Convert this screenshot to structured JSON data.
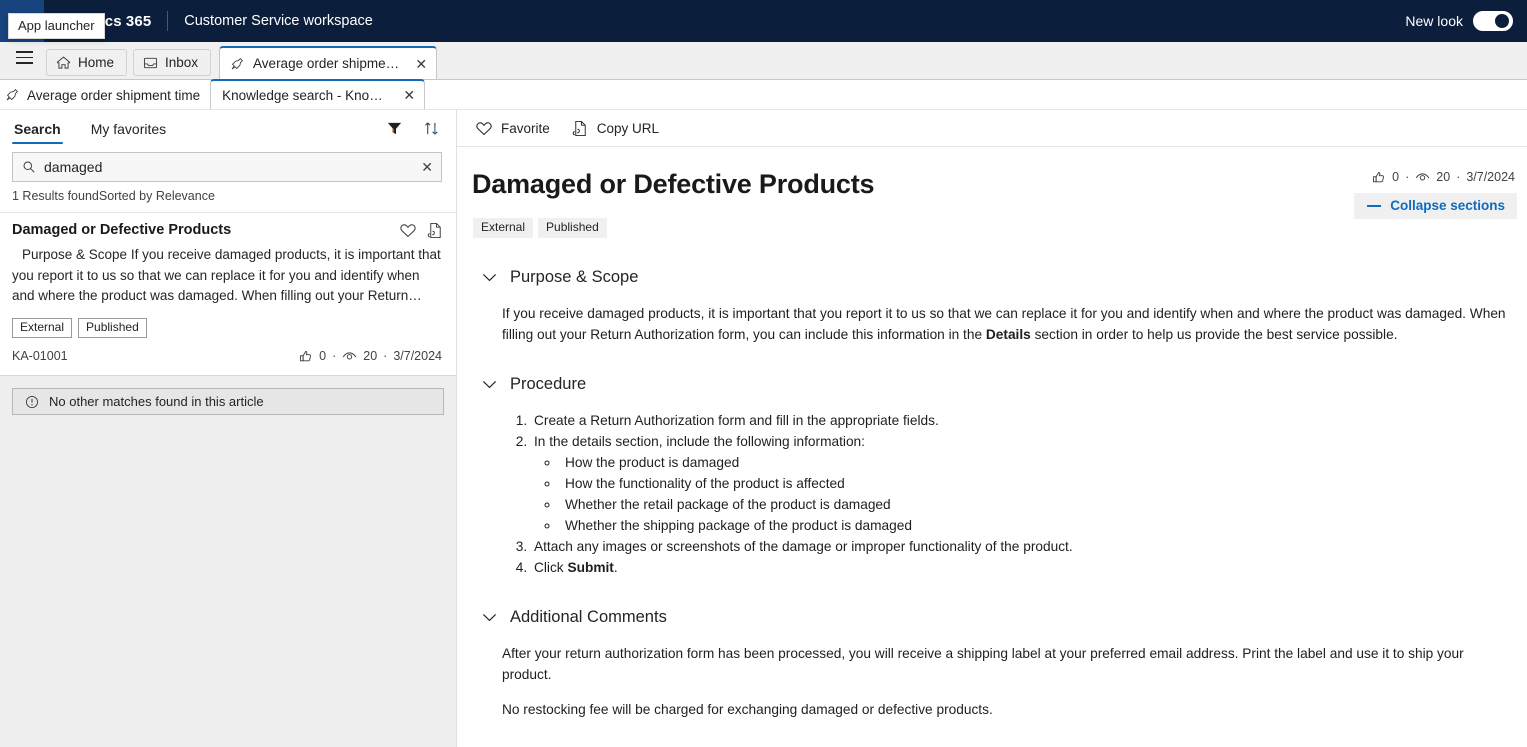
{
  "header": {
    "app_launcher_tooltip": "App launcher",
    "brand": "Dynamics 365",
    "app_name": "Customer Service workspace",
    "new_look_label": "New look",
    "new_look_state": "on",
    "bar_color": "#0b1f3c",
    "accent_color": "#0f6cbd"
  },
  "tabs_primary": [
    {
      "label": "Home",
      "icon": "home-icon"
    },
    {
      "label": "Inbox",
      "icon": "inbox-icon"
    },
    {
      "label": "Average order shipment ti...",
      "icon": "pin-icon",
      "active": true,
      "closable": true
    }
  ],
  "tabs_secondary": [
    {
      "label": "Average order shipment time",
      "icon": "pin-icon",
      "active": false
    },
    {
      "label": "Knowledge search - Knowled...",
      "active": true,
      "closable": true
    }
  ],
  "search_panel": {
    "tabs": [
      {
        "label": "Search",
        "active": true
      },
      {
        "label": "My favorites",
        "active": false
      }
    ],
    "filter_icon": "filter-icon",
    "sort_icon": "sort-icon",
    "search": {
      "value": "damaged",
      "placeholder": "Search",
      "icon": "search-icon",
      "clear_icon": "clear-icon"
    },
    "results_count_text": "1 Results found",
    "sort_text": "Sorted by Relevance",
    "result_card": {
      "title": "Damaged or Defective Products",
      "favorite_icon": "heart-icon",
      "copy_icon": "copy-url-icon",
      "snippet": "Purpose & Scope If you receive damaged products, it is important that you report it to us so that we can replace it for you and identify when and where the product was damaged. When filling out your Return…",
      "badges": [
        "External",
        "Published"
      ],
      "article_number": "KA-01001",
      "likes": "0",
      "views": "20",
      "date": "3/7/2024",
      "separator": "·"
    },
    "no_matches_text": "No other matches found in this article",
    "no_matches_icon": "info-icon"
  },
  "content": {
    "commands": [
      {
        "label": "Favorite",
        "icon": "heart-icon"
      },
      {
        "label": "Copy URL",
        "icon": "copy-url-icon"
      }
    ],
    "title": "Damaged or Defective Products",
    "badges": [
      "External",
      "Published"
    ],
    "stats": {
      "likes": "0",
      "views": "20",
      "date": "3/7/2024",
      "separator": "·"
    },
    "collapse_label": "Collapse sections",
    "sections": [
      {
        "heading": "Purpose & Scope",
        "paragraphs": [
          "If you receive damaged products, it is important that you report it to us so that we can replace it for you and identify when and where the product was damaged. When filling out your Return Authorization form, you can include this information in the Details section in order to help us provide the best service possible."
        ]
      },
      {
        "heading": "Procedure",
        "steps": [
          "Create a Return Authorization form and fill in the appropriate fields.",
          "In the details section, include the following information:",
          "Attach any images or screenshots of the damage or improper functionality of the product.",
          "Click Submit."
        ],
        "substeps": [
          "How the product is damaged",
          "How the functionality of the product is affected",
          "Whether the retail package of the product is damaged",
          "Whether the shipping package of the product is damaged"
        ]
      },
      {
        "heading": "Additional Comments",
        "paragraphs": [
          "After your return authorization form has been processed, you will receive a shipping label at your preferred email address. Print the label and use it to ship your product.",
          "No restocking fee will be charged for exchanging damaged or defective products."
        ]
      }
    ]
  }
}
